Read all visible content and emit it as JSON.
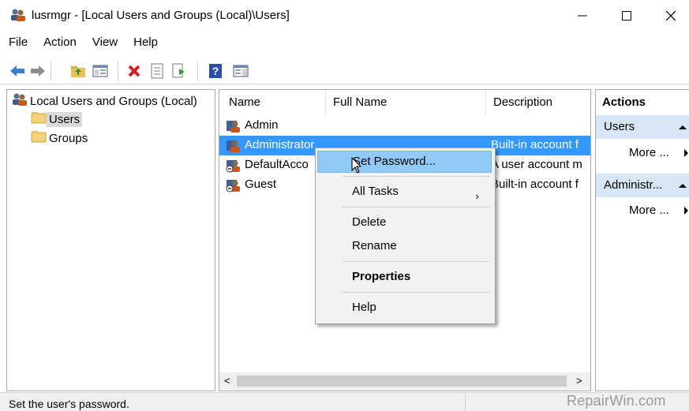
{
  "window": {
    "title": "lusrmgr - [Local Users and Groups (Local)\\Users]",
    "controls": {
      "minimize": "—",
      "maximize": "☐",
      "close": "✕"
    }
  },
  "menubar": [
    "File",
    "Action",
    "View",
    "Help"
  ],
  "toolbar": {
    "buttons": [
      "back-arrow-icon",
      "forward-arrow-icon",
      "up-folder-icon",
      "show-hide-tree-icon",
      "delete-icon",
      "properties-icon",
      "export-list-icon",
      "help-icon",
      "show-hide-action-pane-icon"
    ]
  },
  "tree": {
    "root": "Local Users and Groups (Local)",
    "children": [
      "Users",
      "Groups"
    ],
    "selected": "Users"
  },
  "list": {
    "columns": [
      "Name",
      "Full Name",
      "Description"
    ],
    "rows": [
      {
        "name": "Admin",
        "full_name": "",
        "description": ""
      },
      {
        "name": "Administrator",
        "full_name": "",
        "description": "Built-in account f"
      },
      {
        "name": "DefaultAcco",
        "full_name": "",
        "description": "A user account m"
      },
      {
        "name": "Guest",
        "full_name": "",
        "description": "Built-in account f"
      }
    ],
    "selected_row": "Administrator"
  },
  "context_menu": {
    "items": [
      "Set Password...",
      "All Tasks",
      "Delete",
      "Rename",
      "Properties",
      "Help"
    ],
    "highlighted": "Set Password...",
    "submenu_arrow": "›"
  },
  "actions": {
    "header": "Actions",
    "sections": [
      {
        "title": "Users",
        "items": [
          "More ..."
        ]
      },
      {
        "title": "Administr...",
        "items": [
          "More ..."
        ]
      }
    ]
  },
  "statusbar": {
    "text": "Set the user's password."
  },
  "watermark": "RepairWin.com",
  "colors": {
    "selection": "#3399ff",
    "menu_highlight": "#91c9f7",
    "action_section": "#d6e6f5"
  }
}
